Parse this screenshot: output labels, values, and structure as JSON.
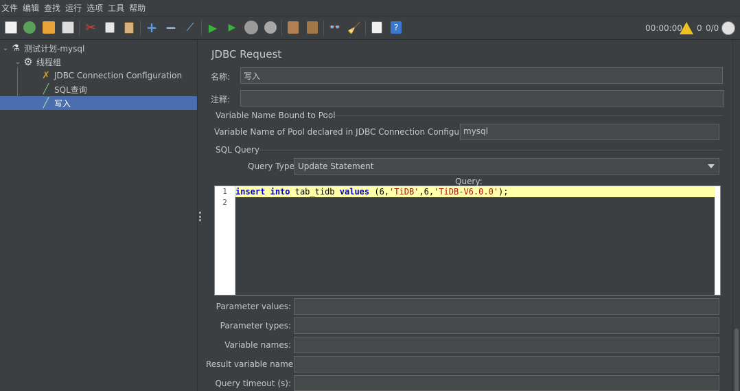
{
  "menu": [
    "文件",
    "编辑",
    "查找",
    "运行",
    "选项",
    "工具",
    "帮助"
  ],
  "toolbar": {
    "timer": "00:00:00",
    "warn_count": "0",
    "threads": "0/0"
  },
  "tree": {
    "plan": "测试计划-mysql",
    "thread_group": "线程组",
    "children": [
      "JDBC Connection Configuration",
      "SQL查询",
      "写入"
    ]
  },
  "panel": {
    "title": "JDBC Request",
    "name_label": "名称:",
    "name_value": "写入",
    "comment_label": "注释:",
    "comment_value": "",
    "pool_section": "Variable Name Bound to Pool",
    "pool_label": "Variable Name of Pool declared in JDBC Connection Configuration:",
    "pool_value": "mysql",
    "sql_section": "SQL Query",
    "query_type_label": "Query Type:",
    "query_type_value": "Update Statement",
    "query_label": "Query:",
    "line_numbers": [
      "1",
      "2"
    ],
    "code": {
      "kw_insert": "insert",
      "kw_into": "into",
      "table": "tab_tidb",
      "kw_values": "values",
      "p1": "(6,",
      "s1": "'TiDB'",
      "p2": ",6,",
      "s2": "'TiDB-V6.0.0'",
      "p3": ");"
    },
    "param_values_label": "Parameter values:",
    "param_types_label": "Parameter types:",
    "var_names_label": "Variable names:",
    "result_var_label": "Result variable name:",
    "timeout_label": "Query timeout (s):"
  },
  "colors": {
    "selection": "#4b6eaf",
    "current_line": "#ffffaa"
  }
}
